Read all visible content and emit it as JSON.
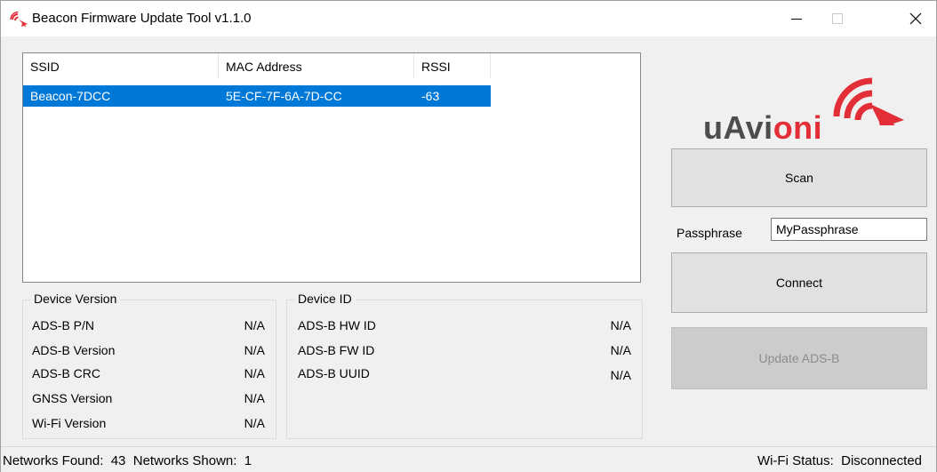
{
  "window": {
    "title": "Beacon Firmware Update Tool v1.1.0",
    "minimize_icon": "minimize-icon",
    "maximize_icon": "maximize-icon",
    "close_icon": "close-icon"
  },
  "networks": {
    "columns": [
      "SSID",
      "MAC Address",
      "RSSI"
    ],
    "rows": [
      {
        "ssid": "Beacon-7DCC",
        "mac": "5E-CF-7F-6A-7D-CC",
        "rssi": "-63"
      }
    ],
    "selected_row_color": "#0078d7"
  },
  "logo": {
    "text": "uAvioni",
    "dark_color": "#4d4d4f",
    "accent_color": "#e32d37"
  },
  "controls": {
    "scan_label": "Scan",
    "passphrase_label": "Passphrase",
    "passphrase_value": "MyPassphrase",
    "connect_label": "Connect",
    "update_label": "Update ADS-B"
  },
  "device_version": {
    "title": "Device Version",
    "items": [
      {
        "label": "ADS-B P/N",
        "value": "N/A"
      },
      {
        "label": "ADS-B Version",
        "value": "N/A"
      },
      {
        "label": "ADS-B CRC",
        "value": "N/A"
      },
      {
        "label": "GNSS Version",
        "value": "N/A"
      },
      {
        "label": "Wi-Fi Version",
        "value": "N/A"
      }
    ]
  },
  "device_id": {
    "title": "Device ID",
    "items": [
      {
        "label": "ADS-B HW ID",
        "value": "N/A"
      },
      {
        "label": "ADS-B FW ID",
        "value": "N/A"
      },
      {
        "label": "ADS-B UUID",
        "value": "N/A"
      }
    ]
  },
  "status": {
    "left": "Networks Found:  43  Networks Shown:  1",
    "right": "Wi-Fi Status:  Disconnected"
  }
}
